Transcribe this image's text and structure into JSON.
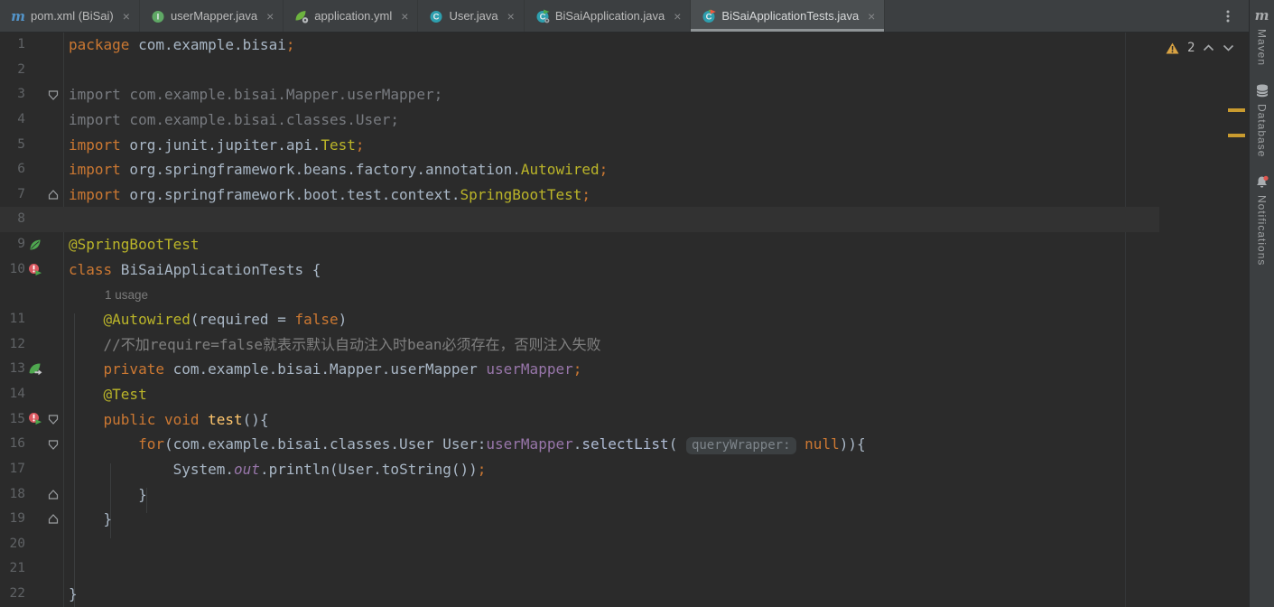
{
  "tabbar": {
    "tabs": [
      {
        "label": "pom.xml (BiSai)",
        "icon": "maven-icon",
        "active": false
      },
      {
        "label": "userMapper.java",
        "icon": "interface-icon",
        "active": false
      },
      {
        "label": "application.yml",
        "icon": "spring-config-icon",
        "active": false
      },
      {
        "label": "User.java",
        "icon": "class-icon",
        "active": false
      },
      {
        "label": "BiSaiApplication.java",
        "icon": "runnable-class-icon",
        "active": false
      },
      {
        "label": "BiSaiApplicationTests.java",
        "icon": "test-class-icon",
        "active": true
      }
    ],
    "close_label": "×"
  },
  "inspection_widget": {
    "warning_count": "2"
  },
  "tool_window_bar": {
    "items": [
      {
        "label": "Maven",
        "icon": "maven-icon"
      },
      {
        "label": "Database",
        "icon": "database-icon"
      },
      {
        "label": "Notifications",
        "icon": "bell-icon"
      }
    ]
  },
  "editor": {
    "rows": [
      {
        "num": "1",
        "segments": [
          [
            "kw",
            "package"
          ],
          [
            "def",
            " com.example.bisai"
          ],
          [
            "semi",
            ";"
          ]
        ]
      },
      {
        "num": "2",
        "segments": []
      },
      {
        "num": "3",
        "fold": "down",
        "segments": [
          [
            "gray",
            "import com.example.bisai.Mapper.userMapper;"
          ]
        ]
      },
      {
        "num": "4",
        "segments": [
          [
            "gray",
            "import com.example.bisai.classes.User;"
          ]
        ]
      },
      {
        "num": "5",
        "segments": [
          [
            "kw",
            "import"
          ],
          [
            "def",
            " org.junit.jupiter.api."
          ],
          [
            "ann",
            "Test"
          ],
          [
            "semi",
            ";"
          ]
        ]
      },
      {
        "num": "6",
        "segments": [
          [
            "kw",
            "import"
          ],
          [
            "def",
            " org.springframework.beans.factory.annotation."
          ],
          [
            "ann",
            "Autowired"
          ],
          [
            "semi",
            ";"
          ]
        ]
      },
      {
        "num": "7",
        "fold": "up",
        "segments": [
          [
            "kw",
            "import"
          ],
          [
            "def",
            " org.springframework.boot.test.context."
          ],
          [
            "ann",
            "SpringBootTest"
          ],
          [
            "semi",
            ";"
          ]
        ]
      },
      {
        "num": "8",
        "current": true,
        "segments": []
      },
      {
        "num": "9",
        "icon": "spring-leaf-icon",
        "segments": [
          [
            "ann",
            "@SpringBootTest"
          ]
        ]
      },
      {
        "num": "10",
        "icon": "run-failed-icon",
        "segments": [
          [
            "kw",
            "class"
          ],
          [
            "def",
            " BiSaiApplicationTests {"
          ]
        ]
      },
      {
        "inlay": true,
        "segments": [
          [
            "usage",
            "1 usage"
          ]
        ]
      },
      {
        "num": "11",
        "segments": [
          [
            "def",
            "    "
          ],
          [
            "ann",
            "@Autowired"
          ],
          [
            "def",
            "(required = "
          ],
          [
            "kw",
            "false"
          ],
          [
            "def",
            ")"
          ]
        ]
      },
      {
        "num": "12",
        "segments": [
          [
            "cmt",
            "    //不加require=false就表示默认自动注入时bean必须存在，否则注入失败"
          ]
        ]
      },
      {
        "num": "13",
        "icon": "spring-bean-icon",
        "segments": [
          [
            "def",
            "    "
          ],
          [
            "kw",
            "private"
          ],
          [
            "def",
            " com.example.bisai.Mapper.userMapper "
          ],
          [
            "fld",
            "userMapper"
          ],
          [
            "semi",
            ";"
          ]
        ]
      },
      {
        "num": "14",
        "segments": [
          [
            "def",
            "    "
          ],
          [
            "ann",
            "@Test"
          ]
        ]
      },
      {
        "num": "15",
        "icon": "run-failed-icon",
        "fold": "down",
        "segments": [
          [
            "def",
            "    "
          ],
          [
            "kw",
            "public"
          ],
          [
            "def",
            " "
          ],
          [
            "kw",
            "void"
          ],
          [
            "def",
            " "
          ],
          [
            "mth",
            "test"
          ],
          [
            "def",
            "(){"
          ]
        ]
      },
      {
        "num": "16",
        "fold": "down",
        "segments": [
          [
            "def",
            "        "
          ],
          [
            "kw",
            "for"
          ],
          [
            "def",
            "(com.example.bisai.classes.User User:"
          ],
          [
            "fld",
            "userMapper"
          ],
          [
            "def",
            "."
          ],
          [
            "call",
            "selectList"
          ],
          [
            "def",
            "( "
          ],
          [
            "hint",
            "queryWrapper:"
          ],
          [
            "def",
            " "
          ],
          [
            "kw",
            "null"
          ],
          [
            "def",
            ")){"
          ]
        ]
      },
      {
        "num": "17",
        "segments": [
          [
            "def",
            "            System."
          ],
          [
            "fldi",
            "out"
          ],
          [
            "def",
            ".println(User.toString())"
          ],
          [
            "semi",
            ";"
          ]
        ]
      },
      {
        "num": "18",
        "fold": "up",
        "segments": [
          [
            "def",
            "        }"
          ]
        ]
      },
      {
        "num": "19",
        "fold": "up",
        "segments": [
          [
            "def",
            "    }"
          ]
        ]
      },
      {
        "num": "20",
        "segments": []
      },
      {
        "num": "21",
        "segments": []
      },
      {
        "num": "22",
        "segments": [
          [
            "def",
            "}"
          ]
        ]
      }
    ]
  }
}
